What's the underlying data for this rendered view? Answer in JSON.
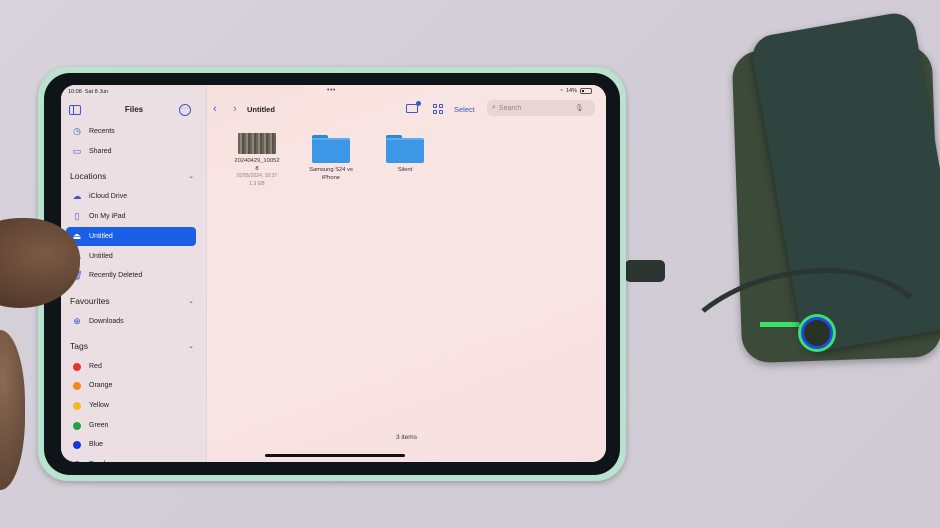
{
  "status_bar": {
    "time": "10:08",
    "date": "Sat 8 Jun",
    "battery": "14%",
    "multitask_dots": "•••"
  },
  "sidebar": {
    "title": "Files",
    "top_items": [
      {
        "label": "Recents",
        "icon": "clock-icon"
      },
      {
        "label": "Shared",
        "icon": "shared-folder-icon"
      }
    ],
    "locations": {
      "header": "Locations",
      "items": [
        {
          "label": "iCloud Drive",
          "icon": "cloud-icon",
          "active": false
        },
        {
          "label": "On My iPad",
          "icon": "ipad-icon",
          "active": false
        },
        {
          "label": "Untitled",
          "icon": "drive-icon",
          "active": true
        },
        {
          "label": "Untitled",
          "icon": "drive-icon",
          "active": false
        },
        {
          "label": "Recently Deleted",
          "icon": "trash-icon",
          "active": false
        }
      ]
    },
    "favourites": {
      "header": "Favourites",
      "items": [
        {
          "label": "Downloads",
          "icon": "download-icon"
        }
      ]
    },
    "tags": {
      "header": "Tags",
      "items": [
        {
          "label": "Red",
          "color": "#e5352b"
        },
        {
          "label": "Orange",
          "color": "#ef8a1d"
        },
        {
          "label": "Yellow",
          "color": "#f0b92a"
        },
        {
          "label": "Green",
          "color": "#2a9d3e"
        },
        {
          "label": "Blue",
          "color": "#1637d8"
        },
        {
          "label": "Purple",
          "color": "#9a3fc4"
        }
      ]
    }
  },
  "toolbar": {
    "title": "Untitled",
    "select_label": "Select",
    "search_placeholder": "Search"
  },
  "files": [
    {
      "name_line1": "20240429_10052",
      "name_line2": "8",
      "date": "02/05/2024, 10:37",
      "size": "1.3 GB",
      "type": "video"
    },
    {
      "name_line1": "Samsung S24 vs",
      "name_line2": "iPhone",
      "type": "folder"
    },
    {
      "name_line1": "Silent",
      "name_line2": "",
      "type": "folder"
    }
  ],
  "footer": {
    "items_count": "3 items"
  },
  "colors": {
    "accent": "#3d55c9",
    "active_bg": "#1b5ee6"
  }
}
